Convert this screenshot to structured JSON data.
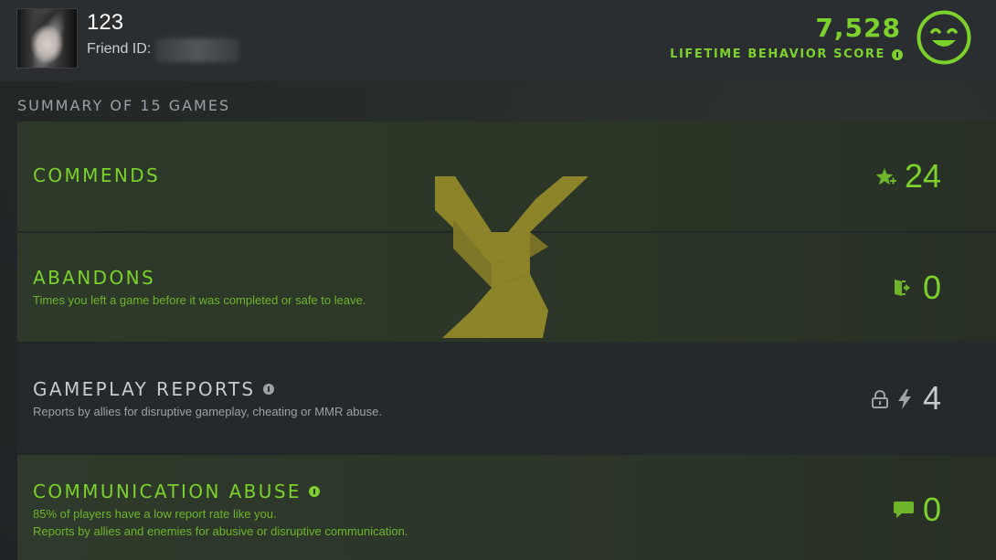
{
  "profile": {
    "username": "123",
    "friend_id_label": "Friend ID:"
  },
  "behavior": {
    "score": "7,528",
    "label": "LIFETIME BEHAVIOR SCORE",
    "icon": "smiley-face-icon"
  },
  "summary": {
    "title": "SUMMARY OF 15 GAMES"
  },
  "rows": {
    "commends": {
      "title": "COMMENDS",
      "value": "24",
      "icon": "star-plus-icon"
    },
    "abandons": {
      "title": "ABANDONS",
      "subtitle": "Times you left a game before it was completed or safe to leave.",
      "value": "0",
      "icon": "exit-door-icon"
    },
    "gameplay_reports": {
      "title": "GAMEPLAY REPORTS",
      "subtitle": "Reports by allies for disruptive gameplay, cheating or MMR abuse.",
      "value": "4",
      "icons": [
        "lock-icon",
        "lightning-icon"
      ]
    },
    "communication_abuse": {
      "title": "COMMUNICATION ABUSE",
      "subtitle_1": "85% of players have a low report rate like you.",
      "subtitle_2": "Reports by allies and enemies for abusive or disruptive communication.",
      "value": "0",
      "icon": "chat-bubble-icon"
    }
  },
  "colors": {
    "accent_green": "#7cd12c",
    "background": "#232629",
    "emblem_gold": "#a99a2a"
  }
}
